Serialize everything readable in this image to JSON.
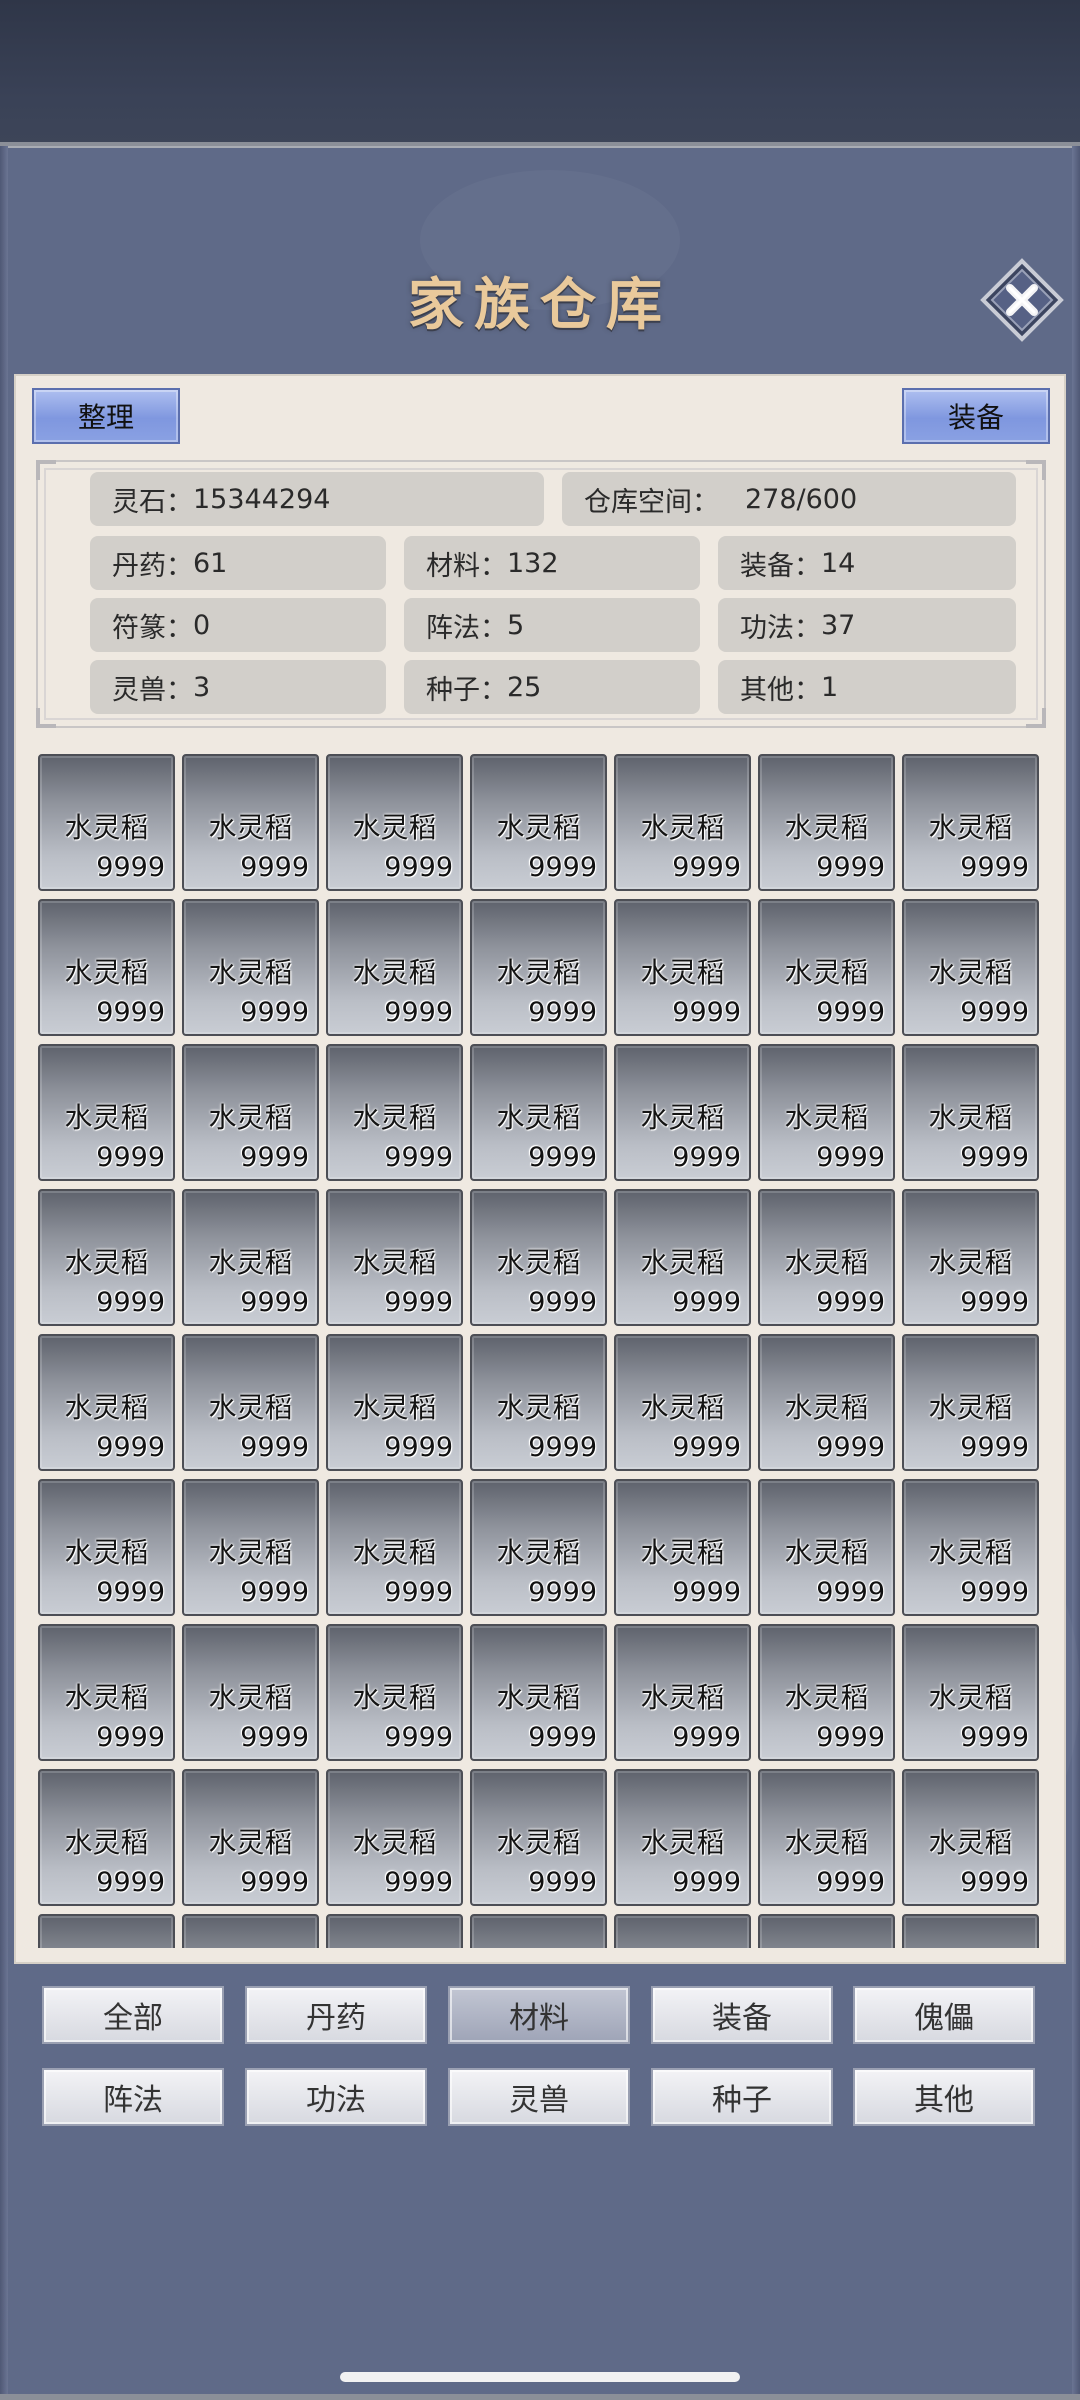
{
  "title": "家族仓库",
  "buttons": {
    "sort": "整理",
    "equip": "装备"
  },
  "stats": [
    {
      "label": "灵石：",
      "value": "15344294"
    },
    {
      "label": "仓库空间：",
      "value": "278/600"
    },
    {
      "label": "丹药：",
      "value": "61"
    },
    {
      "label": "材料：",
      "value": "132"
    },
    {
      "label": "装备：",
      "value": "14"
    },
    {
      "label": "符篆：",
      "value": "0"
    },
    {
      "label": "阵法：",
      "value": "5"
    },
    {
      "label": "功法：",
      "value": "37"
    },
    {
      "label": "灵兽：",
      "value": "3"
    },
    {
      "label": "种子：",
      "value": "25"
    },
    {
      "label": "其他：",
      "value": "1"
    }
  ],
  "grid": {
    "item_name": "水灵稻",
    "item_count": "9999",
    "full_rows": 8,
    "columns": 7
  },
  "categories": [
    {
      "label": "全部",
      "active": false
    },
    {
      "label": "丹药",
      "active": false
    },
    {
      "label": "材料",
      "active": true
    },
    {
      "label": "装备",
      "active": false
    },
    {
      "label": "傀儡",
      "active": false
    },
    {
      "label": "阵法",
      "active": false
    },
    {
      "label": "功法",
      "active": false
    },
    {
      "label": "灵兽",
      "active": false
    },
    {
      "label": "种子",
      "active": false
    },
    {
      "label": "其他",
      "active": false
    }
  ],
  "icons": {
    "close": "close-icon"
  },
  "colors": {
    "background": "#5f6a88",
    "panel": "#efe9e1",
    "title": "#e9c99b",
    "button_blue": "#8aa1e3"
  }
}
